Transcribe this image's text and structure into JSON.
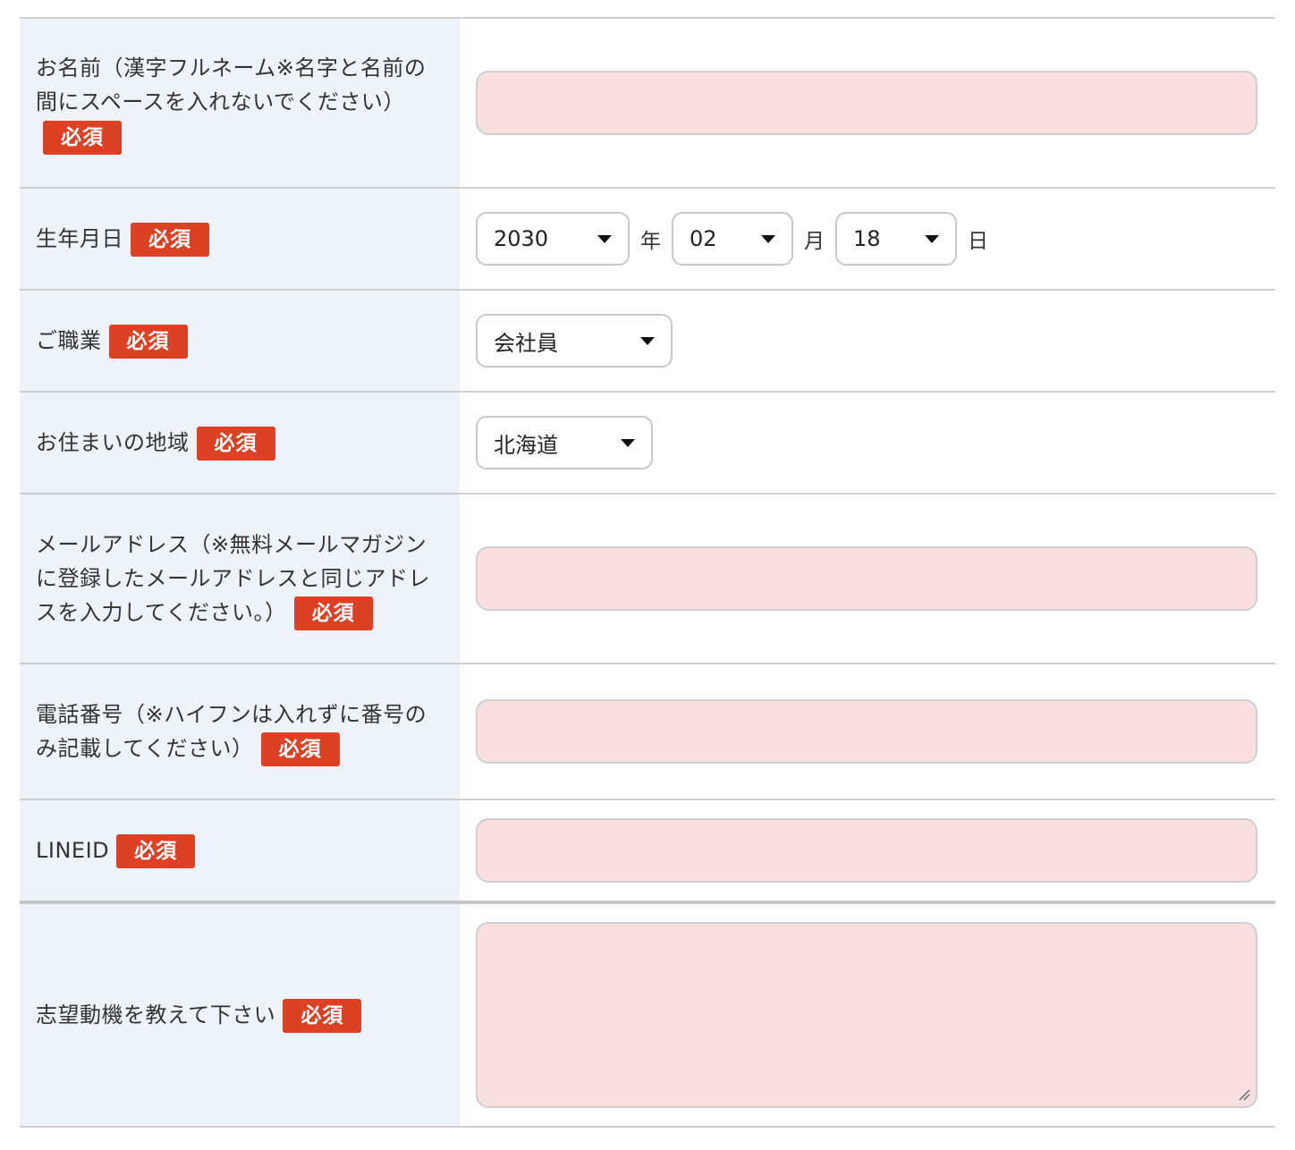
{
  "required_badge": "必須",
  "fields": {
    "name": {
      "label": "お名前（漢字フルネーム※名字と名前の間にスペースを入れないでください）",
      "value": ""
    },
    "birthdate": {
      "label": "生年月日",
      "year": "2030",
      "year_unit": "年",
      "month": "02",
      "month_unit": "月",
      "day": "18",
      "day_unit": "日"
    },
    "occupation": {
      "label": "ご職業",
      "value": "会社員"
    },
    "region": {
      "label": "お住まいの地域",
      "value": "北海道"
    },
    "email": {
      "label": "メールアドレス（※無料メールマガジンに登録したメールアドレスと同じアドレスを入力してください。）",
      "value": ""
    },
    "phone": {
      "label": "電話番号（※ハイフンは入れずに番号のみ記載してください）",
      "value": ""
    },
    "lineid": {
      "label": "LINEID",
      "value": ""
    },
    "motivation": {
      "label": "志望動機を教えて下さい",
      "value": ""
    }
  },
  "colors": {
    "label_bg": "#eef3fa",
    "required_badge": "#dd4124",
    "input_bg": "#f9dfe0"
  },
  "icons": {
    "dropdown": "caret-down-icon",
    "resize": "resize-handle-icon"
  }
}
